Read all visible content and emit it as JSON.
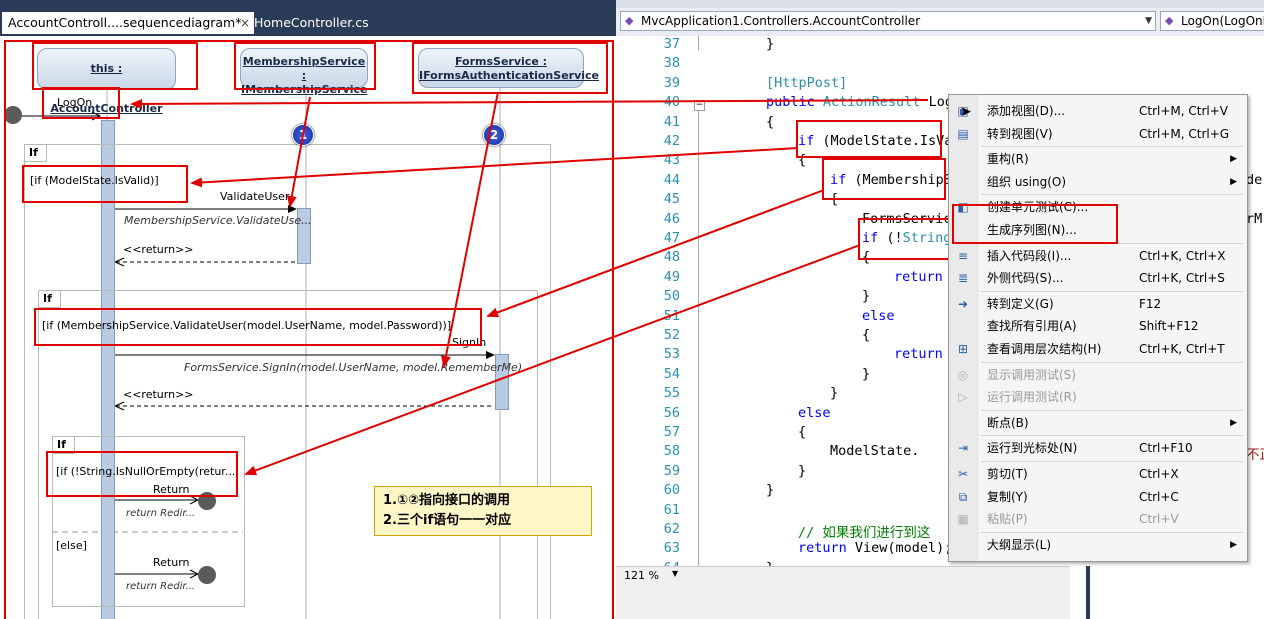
{
  "left_tabs": {
    "active": "AccountControll....sequencediagram*",
    "inactive": "HomeController.cs",
    "close_glyph": "×"
  },
  "diagram": {
    "lifelines": [
      {
        "label": "this : AccountController"
      },
      {
        "label_line1": "MembershipService :",
        "label_line2": "IMembershipService"
      },
      {
        "label_line1": "FormsService :",
        "label_line2": "IFormsAuthenticationService"
      }
    ],
    "logon": "LogOn",
    "frag_if_1": "If",
    "cond_1": "[if (ModelState.IsValid)]",
    "msg_validate": "ValidateUser",
    "msg_validate_sig": "MembershipService.ValidateUse...",
    "return_1": "<<return>>",
    "frag_if_2": "If",
    "cond_2": "[if (MembershipService.ValidateUser(model.UserName, model.Password))]",
    "msg_signin": "SignIn",
    "msg_signin_sig": "FormsService.SignIn(model.UserName, model.RememberMe)",
    "return_2": "<<return>>",
    "frag_if_3": "If",
    "cond_3": "[if  (!String.IsNullOrEmpty(retur...",
    "return_msg_a": "Return",
    "return_redir_a": "return Redir...",
    "else_label": "[else]",
    "return_msg_b": "Return",
    "return_redir_b": "return Redir...",
    "badge_1": "1",
    "badge_2": "2",
    "note_line1": "1.①②指向接口的调用",
    "note_line2": "2.三个if语句一一对应"
  },
  "nav": {
    "class_combo": "MvcApplication1.Controllers.AccountController",
    "member_combo": "LogOn(LogOnM"
  },
  "editor": {
    "lines": [
      {
        "n": "37",
        "t": "}"
      },
      {
        "n": "38",
        "t": ""
      },
      {
        "n": "39",
        "t": "[HttpPost]"
      },
      {
        "n": "40",
        "t": "public ActionResult LogO"
      },
      {
        "n": "41",
        "t": "{"
      },
      {
        "n": "42",
        "t": "if (ModelState.IsVa"
      },
      {
        "n": "43",
        "t": "{"
      },
      {
        "n": "44",
        "t": "if (MembershipS"
      },
      {
        "n": "45",
        "t": "{"
      },
      {
        "n": "46",
        "t": "FormsServic"
      },
      {
        "n": "47",
        "t": "if (!String"
      },
      {
        "n": "48",
        "t": "{"
      },
      {
        "n": "49",
        "t": "return"
      },
      {
        "n": "50",
        "t": "}"
      },
      {
        "n": "51",
        "t": "else"
      },
      {
        "n": "52",
        "t": "{"
      },
      {
        "n": "53",
        "t": "return"
      },
      {
        "n": "54",
        "t": "}"
      },
      {
        "n": "55",
        "t": "}"
      },
      {
        "n": "56",
        "t": "else"
      },
      {
        "n": "57",
        "t": "{"
      },
      {
        "n": "58",
        "t": "ModelState."
      },
      {
        "n": "59",
        "t": "}"
      },
      {
        "n": "60",
        "t": "}"
      },
      {
        "n": "61",
        "t": ""
      },
      {
        "n": "62",
        "t": "// 如果我们进行到这"
      },
      {
        "n": "63",
        "t": "return View(model);"
      },
      {
        "n": "64",
        "t": "}"
      }
    ],
    "right_tail_44": "de",
    "right_tail_46": "rM",
    "right_tail_58": "不正",
    "zoom": "121 %"
  },
  "context_menu": {
    "items": [
      {
        "label": "添加视图(D)...",
        "shortcut": "Ctrl+M, Ctrl+V",
        "icon": "add-view-icon"
      },
      {
        "label": "转到视图(V)",
        "shortcut": "Ctrl+M, Ctrl+G",
        "icon": "goto-view-icon"
      },
      {
        "label": "重构(R)",
        "shortcut": "",
        "submenu": true
      },
      {
        "label": "组织 using(O)",
        "shortcut": "",
        "submenu": true
      },
      {
        "label": "创建单元测试(C)...",
        "shortcut": "",
        "icon": "unit-test-icon"
      },
      {
        "label": "生成序列图(N)...",
        "shortcut": ""
      },
      {
        "label": "插入代码段(I)...",
        "shortcut": "Ctrl+K, Ctrl+X",
        "icon": "snippet-icon"
      },
      {
        "label": "外侧代码(S)...",
        "shortcut": "Ctrl+K, Ctrl+S",
        "icon": "surround-icon"
      },
      {
        "label": "转到定义(G)",
        "shortcut": "F12",
        "icon": "goto-definition-icon"
      },
      {
        "label": "查找所有引用(A)",
        "shortcut": "Shift+F12"
      },
      {
        "label": "查看调用层次结构(H)",
        "shortcut": "Ctrl+K, Ctrl+T",
        "icon": "call-hierarchy-icon"
      },
      {
        "label": "显示调用测试(S)",
        "shortcut": "",
        "disabled": true,
        "icon": "show-tests-icon"
      },
      {
        "label": "运行调用测试(R)",
        "shortcut": "",
        "disabled": true,
        "icon": "run-tests-icon"
      },
      {
        "label": "断点(B)",
        "shortcut": "",
        "submenu": true
      },
      {
        "label": "运行到光标处(N)",
        "shortcut": "Ctrl+F10",
        "icon": "run-to-cursor-icon"
      },
      {
        "label": "剪切(T)",
        "shortcut": "Ctrl+X",
        "icon": "cut-icon"
      },
      {
        "label": "复制(Y)",
        "shortcut": "Ctrl+C",
        "icon": "copy-icon"
      },
      {
        "label": "粘贴(P)",
        "shortcut": "Ctrl+V",
        "disabled": true,
        "icon": "paste-icon"
      },
      {
        "label": "大纲显示(L)",
        "shortcut": "",
        "submenu": true
      }
    ]
  },
  "colors": {
    "annotation_red": "#e00000",
    "tab_bar": "#2b3c59",
    "keyword_blue": "#0000ff",
    "type_teal": "#2b91af",
    "comment_green": "#008000"
  }
}
